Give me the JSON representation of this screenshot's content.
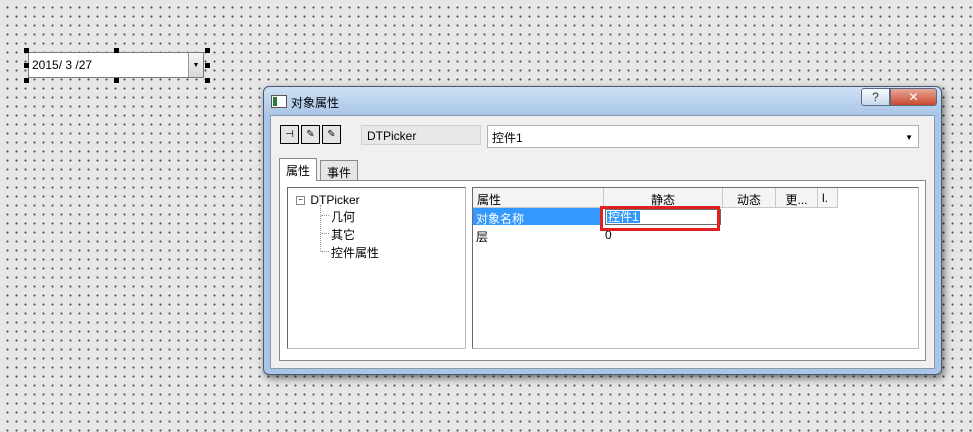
{
  "canvas": {
    "datepicker_value": "2015/ 3 /27",
    "datepicker_arrow": "▼"
  },
  "dialog": {
    "title": "对象属性",
    "help_label": "?",
    "close_label": "✕",
    "toolbar": {
      "pin_label": "⊣",
      "tool2_label": "✎",
      "tool3_label": "✎"
    },
    "object_type": "DTPicker",
    "object_name": "控件1",
    "combo_arrow": "▼",
    "tabs": [
      {
        "label": "属性"
      },
      {
        "label": "事件"
      }
    ],
    "tree": {
      "root": "DTPicker",
      "toggle": "−",
      "children": [
        "几何",
        "其它",
        "控件属性"
      ]
    },
    "grid": {
      "headers": [
        "属性",
        "静态",
        "动态",
        "更...",
        "l."
      ],
      "rows": [
        {
          "name": "对象名称",
          "static": "控件1"
        },
        {
          "name": "层",
          "static": "0"
        }
      ]
    }
  }
}
